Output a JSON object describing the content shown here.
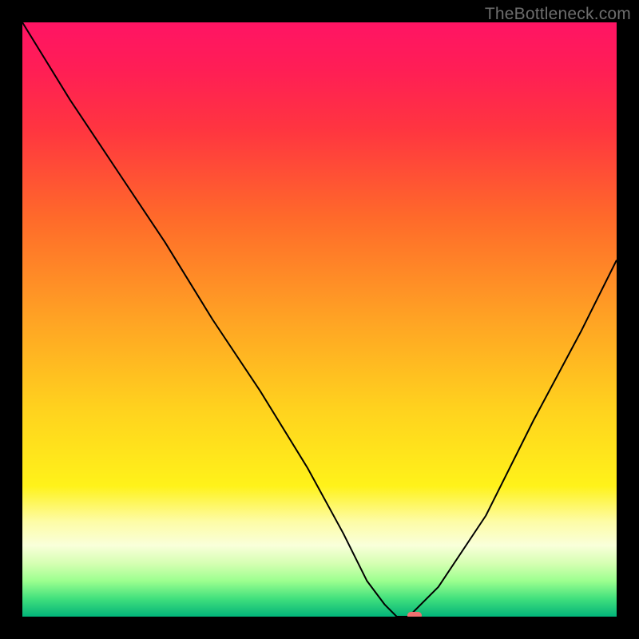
{
  "watermark": "TheBottleneck.com",
  "chart_data": {
    "type": "line",
    "title": "",
    "xlabel": "",
    "ylabel": "",
    "xlim": [
      0,
      100
    ],
    "ylim": [
      0,
      100
    ],
    "x": [
      0,
      8,
      16,
      24,
      32,
      40,
      48,
      54,
      58,
      61,
      63,
      65,
      70,
      78,
      86,
      94,
      100
    ],
    "values": [
      100,
      87,
      75,
      63,
      50,
      38,
      25,
      14,
      6,
      2,
      0,
      0,
      5,
      17,
      33,
      48,
      60
    ],
    "marker_x": 66,
    "marker_y": 0,
    "background_gradient": {
      "top": "#ff1464",
      "upper_mid": "#ff6a2a",
      "mid": "#ffd21e",
      "lower_mid": "#fdfca6",
      "bottom": "#00b57a"
    }
  }
}
